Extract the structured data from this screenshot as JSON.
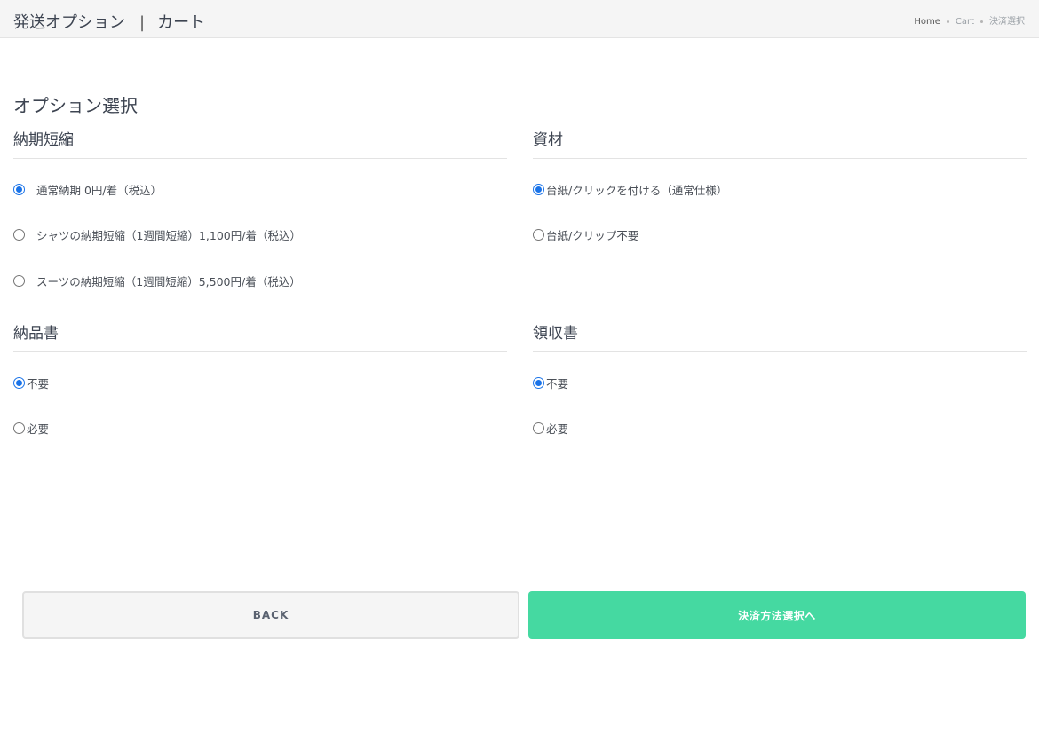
{
  "header": {
    "title": "発送オプション",
    "separator": "|",
    "subtitle": "カート",
    "breadcrumb": [
      "Home",
      "Cart",
      "決済選択"
    ]
  },
  "main": {
    "section_title": "オプション選択",
    "groups": {
      "delivery": {
        "title": "納期短縮",
        "options": [
          {
            "label": "通常納期 0円/着（税込）",
            "checked": true
          },
          {
            "label": "シャツの納期短縮（1週間短縮）1,100円/着（税込）",
            "checked": false
          },
          {
            "label": "スーツの納期短縮（1週間短縮）5,500円/着（税込）",
            "checked": false
          }
        ]
      },
      "material": {
        "title": "資材",
        "options": [
          {
            "label": "台紙/クリックを付ける（通常仕様）",
            "checked": true
          },
          {
            "label": "台紙/クリップ不要",
            "checked": false
          }
        ]
      },
      "invoice": {
        "title": "納品書",
        "options": [
          {
            "label": "不要",
            "checked": true
          },
          {
            "label": "必要",
            "checked": false
          }
        ]
      },
      "receipt": {
        "title": "領収書",
        "options": [
          {
            "label": "不要",
            "checked": true
          },
          {
            "label": "必要",
            "checked": false
          }
        ]
      }
    }
  },
  "actions": {
    "back_label": "BACK",
    "next_label": "決済方法選択へ"
  },
  "colors": {
    "accent": "#45d9a1",
    "radio_checked": "#1a73e8"
  }
}
